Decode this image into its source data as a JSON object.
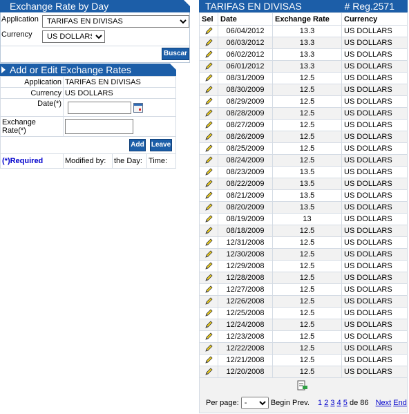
{
  "rate_by_day": {
    "title": "Exchange Rate by Day",
    "application_label": "Application",
    "application_value": "TARIFAS EN DIVISAS",
    "currency_label": "Currency",
    "currency_value": "US DOLLARS",
    "search_button": "Buscar"
  },
  "edit_form": {
    "title": "Add or Edit Exchange Rates",
    "application_label": "Application",
    "application_value": "TARIFAS EN DIVISAS",
    "currency_label": "Currency",
    "currency_value": "US DOLLARS",
    "date_label": "Date(*)",
    "rate_label": "Exchange Rate(*)",
    "add_button": "Add",
    "leave_button": "Leave",
    "required_note": "(*)Required",
    "modified_by_label": "Modified by:",
    "day_label": "the Day:",
    "time_label": "Time:"
  },
  "grid": {
    "title": "TARIFAS EN DIVISAS",
    "reg_count": "# Reg.2571",
    "columns": [
      "Sel",
      "Date",
      "Exchange Rate",
      "Currency"
    ],
    "rows": [
      {
        "date": "06/04/2012",
        "rate": "13.3",
        "currency": "US DOLLARS"
      },
      {
        "date": "06/03/2012",
        "rate": "13.3",
        "currency": "US DOLLARS"
      },
      {
        "date": "06/02/2012",
        "rate": "13.3",
        "currency": "US DOLLARS"
      },
      {
        "date": "06/01/2012",
        "rate": "13.3",
        "currency": "US DOLLARS"
      },
      {
        "date": "08/31/2009",
        "rate": "12.5",
        "currency": "US DOLLARS"
      },
      {
        "date": "08/30/2009",
        "rate": "12.5",
        "currency": "US DOLLARS"
      },
      {
        "date": "08/29/2009",
        "rate": "12.5",
        "currency": "US DOLLARS"
      },
      {
        "date": "08/28/2009",
        "rate": "12.5",
        "currency": "US DOLLARS"
      },
      {
        "date": "08/27/2009",
        "rate": "12.5",
        "currency": "US DOLLARS"
      },
      {
        "date": "08/26/2009",
        "rate": "12.5",
        "currency": "US DOLLARS"
      },
      {
        "date": "08/25/2009",
        "rate": "12.5",
        "currency": "US DOLLARS"
      },
      {
        "date": "08/24/2009",
        "rate": "12.5",
        "currency": "US DOLLARS"
      },
      {
        "date": "08/23/2009",
        "rate": "13.5",
        "currency": "US DOLLARS"
      },
      {
        "date": "08/22/2009",
        "rate": "13.5",
        "currency": "US DOLLARS"
      },
      {
        "date": "08/21/2009",
        "rate": "13.5",
        "currency": "US DOLLARS"
      },
      {
        "date": "08/20/2009",
        "rate": "13.5",
        "currency": "US DOLLARS"
      },
      {
        "date": "08/19/2009",
        "rate": "13",
        "currency": "US DOLLARS"
      },
      {
        "date": "08/18/2009",
        "rate": "12.5",
        "currency": "US DOLLARS"
      },
      {
        "date": "12/31/2008",
        "rate": "12.5",
        "currency": "US DOLLARS"
      },
      {
        "date": "12/30/2008",
        "rate": "12.5",
        "currency": "US DOLLARS"
      },
      {
        "date": "12/29/2008",
        "rate": "12.5",
        "currency": "US DOLLARS"
      },
      {
        "date": "12/28/2008",
        "rate": "12.5",
        "currency": "US DOLLARS"
      },
      {
        "date": "12/27/2008",
        "rate": "12.5",
        "currency": "US DOLLARS"
      },
      {
        "date": "12/26/2008",
        "rate": "12.5",
        "currency": "US DOLLARS"
      },
      {
        "date": "12/25/2008",
        "rate": "12.5",
        "currency": "US DOLLARS"
      },
      {
        "date": "12/24/2008",
        "rate": "12.5",
        "currency": "US DOLLARS"
      },
      {
        "date": "12/23/2008",
        "rate": "12.5",
        "currency": "US DOLLARS"
      },
      {
        "date": "12/22/2008",
        "rate": "12.5",
        "currency": "US DOLLARS"
      },
      {
        "date": "12/21/2008",
        "rate": "12.5",
        "currency": "US DOLLARS"
      },
      {
        "date": "12/20/2008",
        "rate": "12.5",
        "currency": "US DOLLARS"
      }
    ],
    "per_page_label": "Per page:",
    "per_page_value": "-",
    "begin_label": "Begin",
    "prev_label": "Prev.",
    "pages": [
      "1",
      "2",
      "3",
      "4",
      "5"
    ],
    "of_label": "de 86",
    "next_label": "Next",
    "end_label": "End"
  },
  "icons": {
    "edit": "pencil-icon",
    "calendar": "calendar-icon",
    "export": "excel-export-icon"
  },
  "colors": {
    "header_blue": "#1c5ea8",
    "link_blue": "#0000cc",
    "pencil_yellow": "#f2d21b"
  }
}
